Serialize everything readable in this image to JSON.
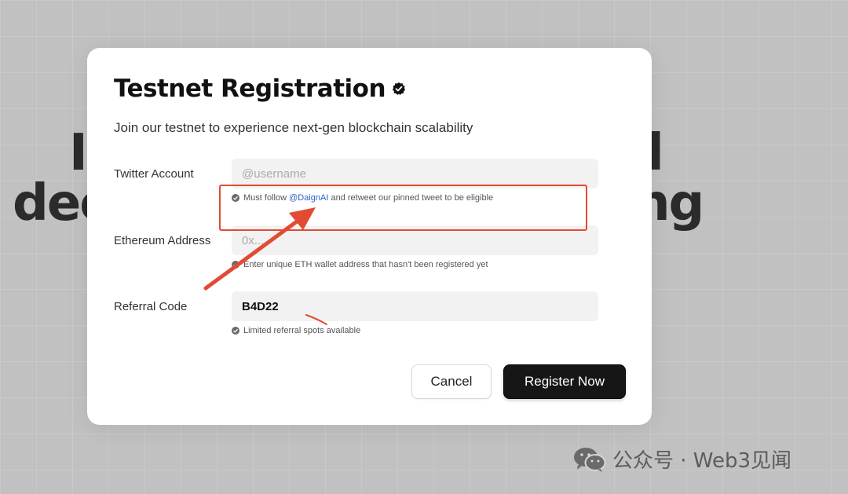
{
  "background": {
    "headline_line1_left": "I",
    "headline_line1_right": "d",
    "headline_line2_left": "dec",
    "headline_line2_right": "ing"
  },
  "modal": {
    "title": "Testnet Registration",
    "subtitle": "Join our testnet to experience next-gen blockchain scalability",
    "fields": [
      {
        "label": "Twitter Account",
        "placeholder": "@username",
        "value": "",
        "hint_prefix": "Must follow ",
        "hint_link": "@DaignAI",
        "hint_suffix": " and retweet our pinned tweet to be eligible"
      },
      {
        "label": "Ethereum Address",
        "placeholder": "0x...",
        "value": "",
        "hint": "Enter unique ETH wallet address that hasn't been registered yet"
      },
      {
        "label": "Referral Code",
        "placeholder": "",
        "value": "B4D22",
        "hint": "Limited referral spots available"
      }
    ],
    "buttons": {
      "cancel": "Cancel",
      "register": "Register Now"
    }
  },
  "watermark": {
    "text": "公众号 · Web3见闻",
    "icon": "wechat-icon"
  },
  "colors": {
    "accent_link": "#2b63c9",
    "annotation": "#e34a33",
    "primary_button": "#161616"
  }
}
